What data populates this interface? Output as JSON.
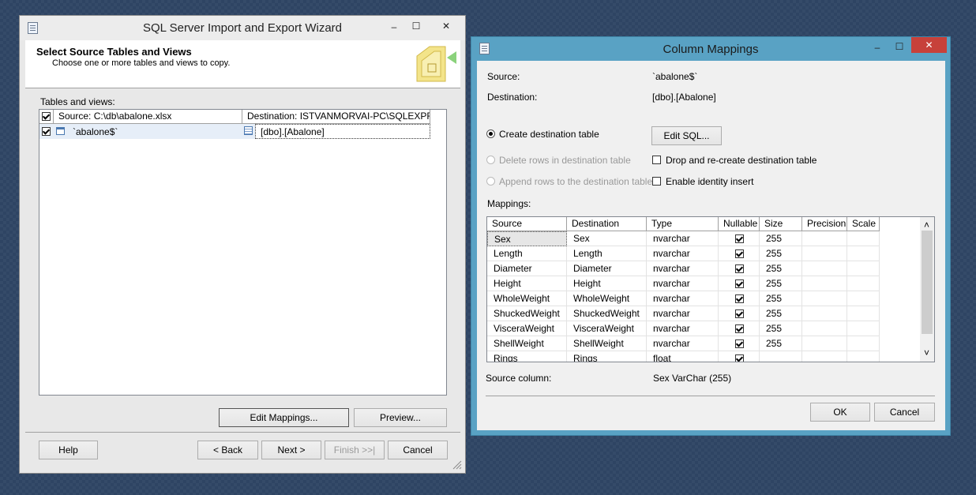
{
  "wizard": {
    "title": "SQL Server Import and Export Wizard",
    "minimize": "–",
    "maximize": "☐",
    "close": "✕",
    "header_title": "Select Source Tables and Views",
    "header_subtitle": "Choose one or more tables and views to copy.",
    "tables_label": "Tables and views:",
    "col_source": "Source: C:\\db\\abalone.xlsx",
    "col_destination": "Destination: ISTVANMORVAI-PC\\SQLEXPRE...",
    "row_source": "`abalone$`",
    "row_destination": "[dbo].[Abalone]",
    "edit_mappings": "Edit Mappings...",
    "preview": "Preview...",
    "help": "Help",
    "back": "< Back",
    "next": "Next >",
    "finish": "Finish >>|",
    "cancel": "Cancel"
  },
  "mapping": {
    "title": "Column Mappings",
    "minimize": "–",
    "maximize": "☐",
    "close": "✕",
    "source_label": "Source:",
    "source_value": "`abalone$`",
    "destination_label": "Destination:",
    "destination_value": "[dbo].[Abalone]",
    "create_table": "Create destination table",
    "edit_sql": "Edit SQL...",
    "delete_rows": "Delete rows in destination table",
    "drop_recreate": "Drop and re-create destination table",
    "append_rows": "Append rows to the destination table",
    "identity_insert": "Enable identity insert",
    "mappings_label": "Mappings:",
    "columns": [
      "Source",
      "Destination",
      "Type",
      "Nullable",
      "Size",
      "Precision",
      "Scale"
    ],
    "rows": [
      {
        "source": "Sex",
        "destination": "Sex",
        "type": "nvarchar",
        "nullable": true,
        "size": "255"
      },
      {
        "source": "Length",
        "destination": "Length",
        "type": "nvarchar",
        "nullable": true,
        "size": "255"
      },
      {
        "source": "Diameter",
        "destination": "Diameter",
        "type": "nvarchar",
        "nullable": true,
        "size": "255"
      },
      {
        "source": "Height",
        "destination": "Height",
        "type": "nvarchar",
        "nullable": true,
        "size": "255"
      },
      {
        "source": "WholeWeight",
        "destination": "WholeWeight",
        "type": "nvarchar",
        "nullable": true,
        "size": "255"
      },
      {
        "source": "ShuckedWeight",
        "destination": "ShuckedWeight",
        "type": "nvarchar",
        "nullable": true,
        "size": "255"
      },
      {
        "source": "VisceraWeight",
        "destination": "VisceraWeight",
        "type": "nvarchar",
        "nullable": true,
        "size": "255"
      },
      {
        "source": "ShellWeight",
        "destination": "ShellWeight",
        "type": "nvarchar",
        "nullable": true,
        "size": "255"
      },
      {
        "source": "Rings",
        "destination": "Rings",
        "type": "float",
        "nullable": true,
        "size": ""
      }
    ],
    "source_column_label": "Source column:",
    "source_column_value": "Sex VarChar (255)",
    "ok": "OK",
    "cancel": "Cancel",
    "scroll_up": "˄",
    "scroll_down": "˅"
  },
  "colors": {
    "desktop": "#2e4463",
    "mapping_frame": "#59a2c4",
    "close_button": "#c7413a"
  }
}
